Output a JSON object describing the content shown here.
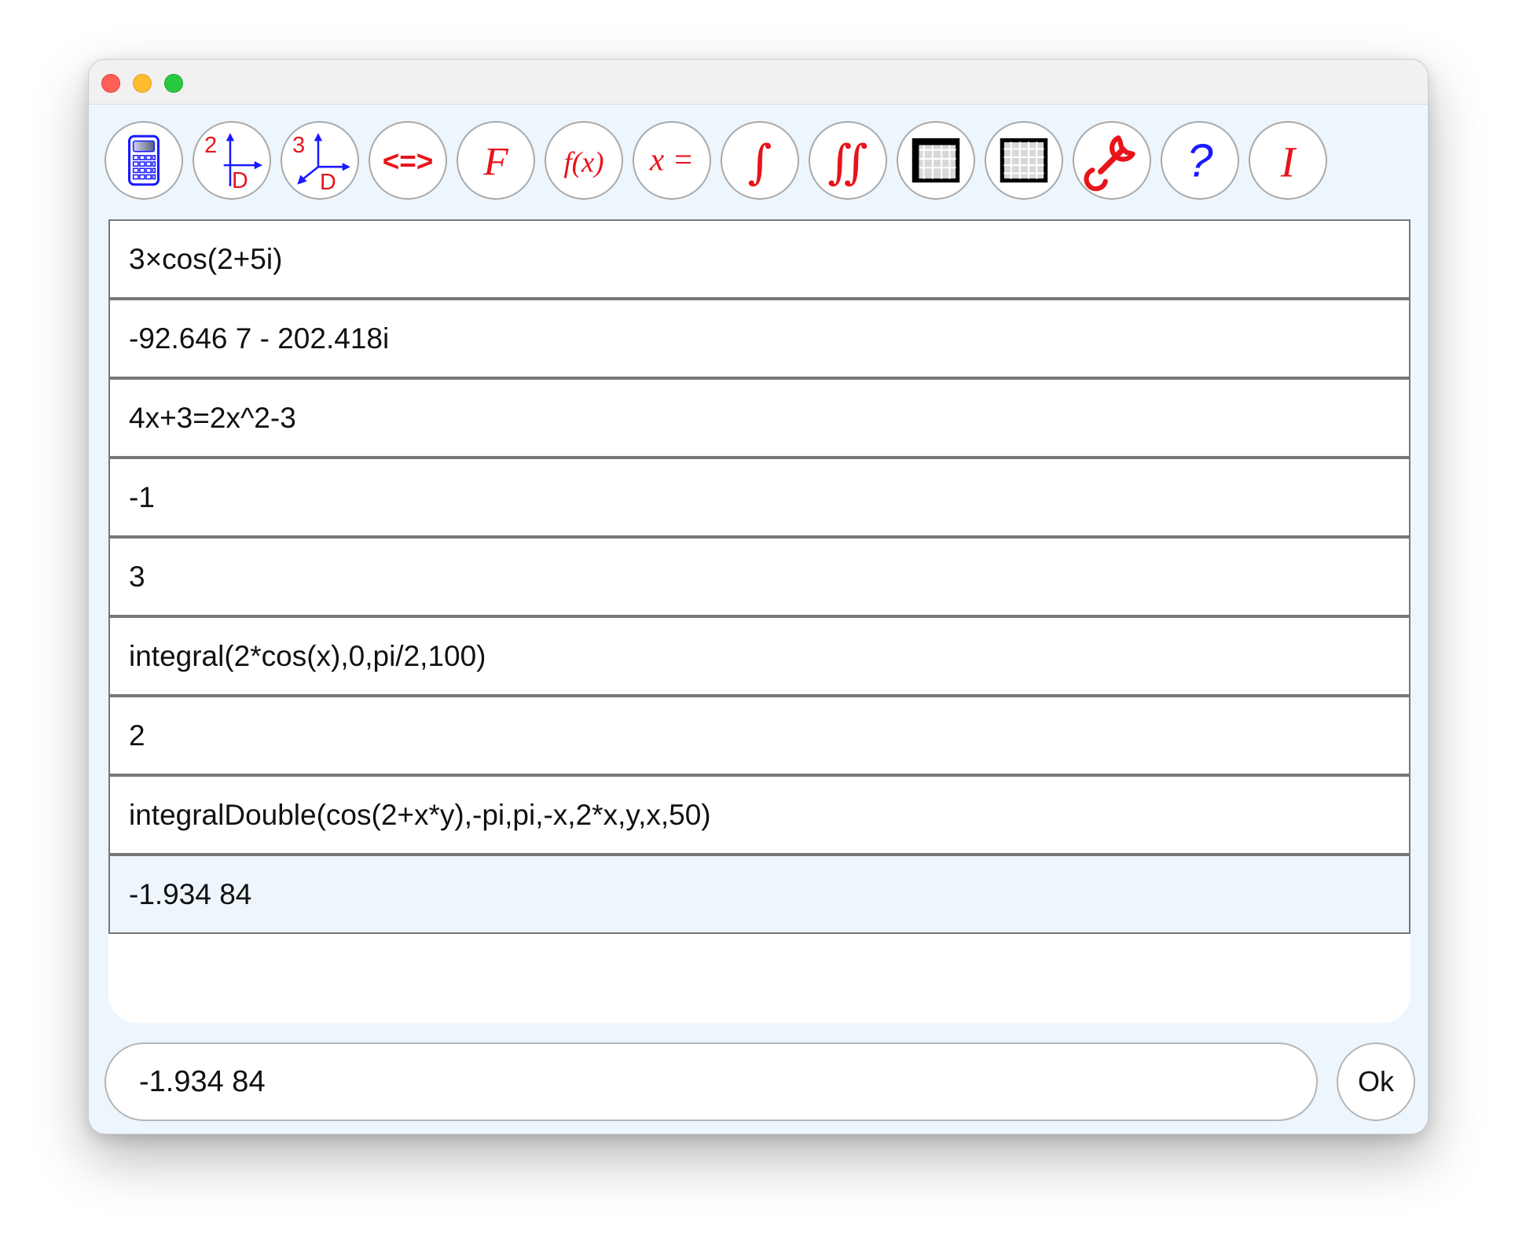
{
  "window": {
    "controls": [
      "close",
      "minimize",
      "maximize"
    ]
  },
  "toolbar": {
    "items": [
      {
        "name": "calculator",
        "icon": "calculator-icon"
      },
      {
        "name": "plot-2d",
        "icon": "plot-2d-icon",
        "text": "2D"
      },
      {
        "name": "plot-3d",
        "icon": "plot-3d-icon",
        "text": "3D"
      },
      {
        "name": "inequality",
        "icon": "inequality-icon",
        "text": "<=>"
      },
      {
        "name": "fourier",
        "icon": "fourier-icon",
        "text": "F"
      },
      {
        "name": "function",
        "icon": "function-icon",
        "text": "f(x)"
      },
      {
        "name": "equation",
        "icon": "equation-icon",
        "text": "x ="
      },
      {
        "name": "integral",
        "icon": "integral-icon",
        "text": "∫"
      },
      {
        "name": "double-integral",
        "icon": "double-integral-icon",
        "text": "∬"
      },
      {
        "name": "matrix",
        "icon": "matrix-icon"
      },
      {
        "name": "table",
        "icon": "table-icon"
      },
      {
        "name": "settings",
        "icon": "wrench-icon"
      },
      {
        "name": "help",
        "icon": "help-icon",
        "text": "?"
      },
      {
        "name": "info",
        "icon": "info-icon",
        "text": "I"
      }
    ]
  },
  "history": [
    "3×cos(2+5i)",
    "-92.646 7 - 202.418i",
    "4x+3=2x^2-3",
    "-1",
    "3",
    "integral(2*cos(x),0,pi/2,100)",
    "2",
    "integralDouble(cos(2+x*y),-pi,pi,-x,2*x,y,x,50)",
    "-1.934 84"
  ],
  "input": {
    "value": "-1.934 84"
  },
  "ok_label": "Ok",
  "colors": {
    "accent_red": "#e8131b",
    "accent_blue": "#1a1aff",
    "background": "#eef6fd",
    "selected_row": "#eef6fd"
  }
}
